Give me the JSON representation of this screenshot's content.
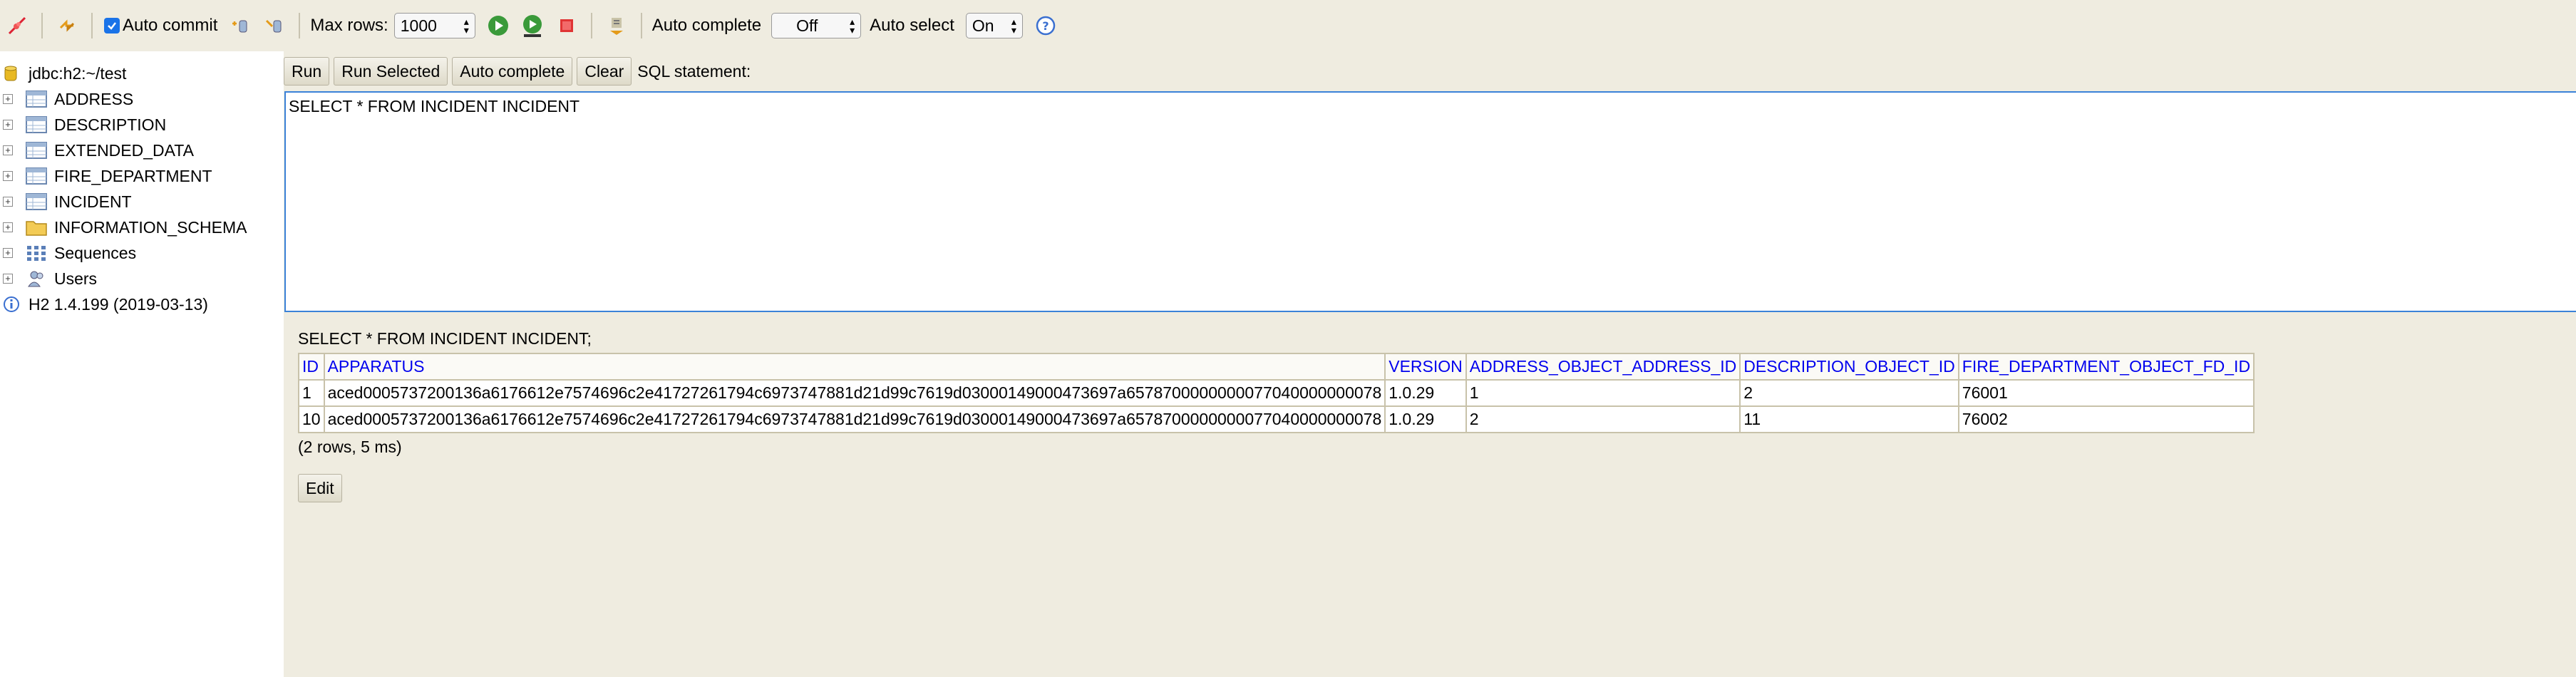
{
  "toolbar": {
    "auto_commit_label": "Auto commit",
    "auto_commit_checked": true,
    "max_rows_label": "Max rows:",
    "max_rows_value": "1000",
    "auto_complete_label": "Auto complete",
    "auto_complete_value": "Off",
    "auto_select_label": "Auto select",
    "auto_select_value": "On",
    "help_glyph": "?"
  },
  "sidebar": {
    "connection": "jdbc:h2:~/test",
    "items": [
      {
        "label": "ADDRESS",
        "icon": "table-icon"
      },
      {
        "label": "DESCRIPTION",
        "icon": "table-icon"
      },
      {
        "label": "EXTENDED_DATA",
        "icon": "table-icon"
      },
      {
        "label": "FIRE_DEPARTMENT",
        "icon": "table-icon"
      },
      {
        "label": "INCIDENT",
        "icon": "table-icon"
      },
      {
        "label": "INFORMATION_SCHEMA",
        "icon": "folder-icon"
      },
      {
        "label": "Sequences",
        "icon": "sequences-icon"
      },
      {
        "label": "Users",
        "icon": "users-icon"
      }
    ],
    "version": "H2 1.4.199 (2019-03-13)"
  },
  "editor": {
    "run_label": "Run",
    "run_selected_label": "Run Selected",
    "auto_complete_label": "Auto complete",
    "clear_label": "Clear",
    "sql_statement_label": "SQL statement:",
    "sql_text": "SELECT * FROM INCIDENT INCIDENT"
  },
  "result": {
    "sql": "SELECT * FROM INCIDENT INCIDENT;",
    "columns": [
      "ID",
      "APPARATUS",
      "VERSION",
      "ADDRESS_OBJECT_ADDRESS_ID",
      "DESCRIPTION_OBJECT_ID",
      "FIRE_DEPARTMENT_OBJECT_FD_ID"
    ],
    "rows": [
      [
        "1",
        "aced0005737200136a6176612e7574696c2e41727261794c6973747881d21d99c7619d03000149000473697a6578700000000077040000000078",
        "1.0.29",
        "1",
        "2",
        "76001"
      ],
      [
        "10",
        "aced0005737200136a6176612e7574696c2e41727261794c6973747881d21d99c7619d03000149000473697a6578700000000077040000000078",
        "1.0.29",
        "2",
        "11",
        "76002"
      ]
    ],
    "status": "(2 rows, 5 ms)",
    "edit_label": "Edit"
  },
  "colors": {
    "background": "#efece0",
    "header_link": "#0000ee",
    "editor_border": "#3b82d8"
  }
}
